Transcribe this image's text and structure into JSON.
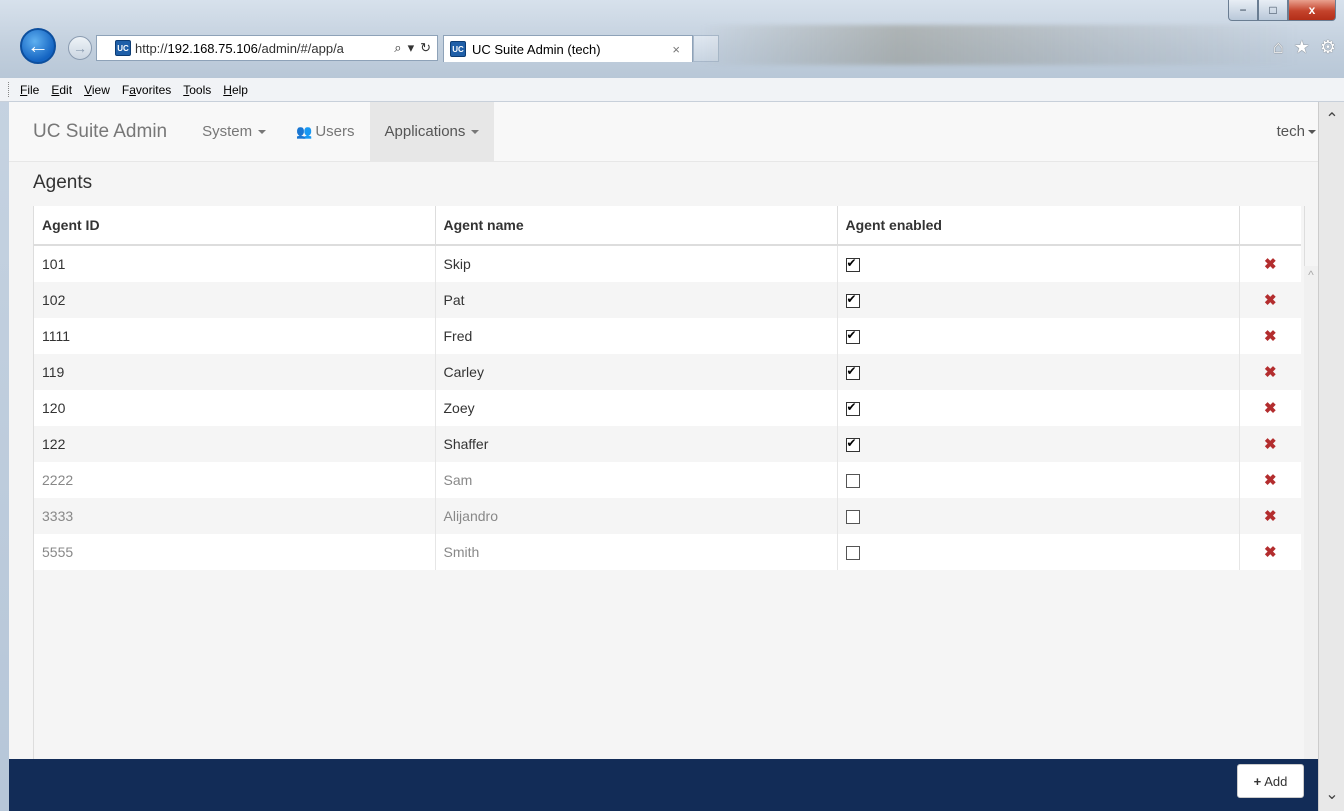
{
  "browser": {
    "address_url_prefix": "http://",
    "address_url_host": "192.168.75.106",
    "address_url_rest": "/admin/#/app/a",
    "search_glyph": "⌕",
    "dropdown_glyph": "▾",
    "refresh_glyph": "↻",
    "tab_title": "UC Suite Admin (tech)",
    "tab_close": "×",
    "favicon_text": "UC",
    "window_min": "−",
    "window_max": "□",
    "window_close": "x",
    "icons": {
      "back": "arrow-left-icon",
      "forward": "arrow-right-icon",
      "home": "home-icon",
      "favorites": "star-icon",
      "settings": "gear-icon"
    }
  },
  "menubar": {
    "items": [
      {
        "key": "F",
        "rest": "ile"
      },
      {
        "key": "E",
        "rest": "dit"
      },
      {
        "key": "V",
        "rest": "iew"
      },
      {
        "pre": "F",
        "key": "a",
        "rest": "vorites"
      },
      {
        "key": "T",
        "rest": "ools"
      },
      {
        "key": "H",
        "rest": "elp"
      }
    ]
  },
  "navbar": {
    "brand": "UC Suite Admin",
    "system": "System",
    "users": "Users",
    "applications": "Applications",
    "user": "tech"
  },
  "page": {
    "heading": "Agents",
    "columns": [
      "Agent ID",
      "Agent name",
      "Agent enabled"
    ],
    "rows": [
      {
        "id": "101",
        "name": "Skip",
        "enabled": true
      },
      {
        "id": "102",
        "name": "Pat",
        "enabled": true
      },
      {
        "id": "1111",
        "name": "Fred",
        "enabled": true
      },
      {
        "id": "119",
        "name": "Carley",
        "enabled": true
      },
      {
        "id": "120",
        "name": "Zoey",
        "enabled": true
      },
      {
        "id": "122",
        "name": "Shaffer",
        "enabled": true
      },
      {
        "id": "2222",
        "name": "Sam",
        "enabled": false
      },
      {
        "id": "3333",
        "name": "Alijandro",
        "enabled": false
      },
      {
        "id": "5555",
        "name": "Smith",
        "enabled": false
      }
    ],
    "delete_glyph": "✖",
    "add_label": "Add",
    "add_glyph": "+"
  },
  "colors": {
    "footer": "#122c57",
    "delete": "#b32d2e",
    "nav_bg": "#f8f8f8"
  }
}
